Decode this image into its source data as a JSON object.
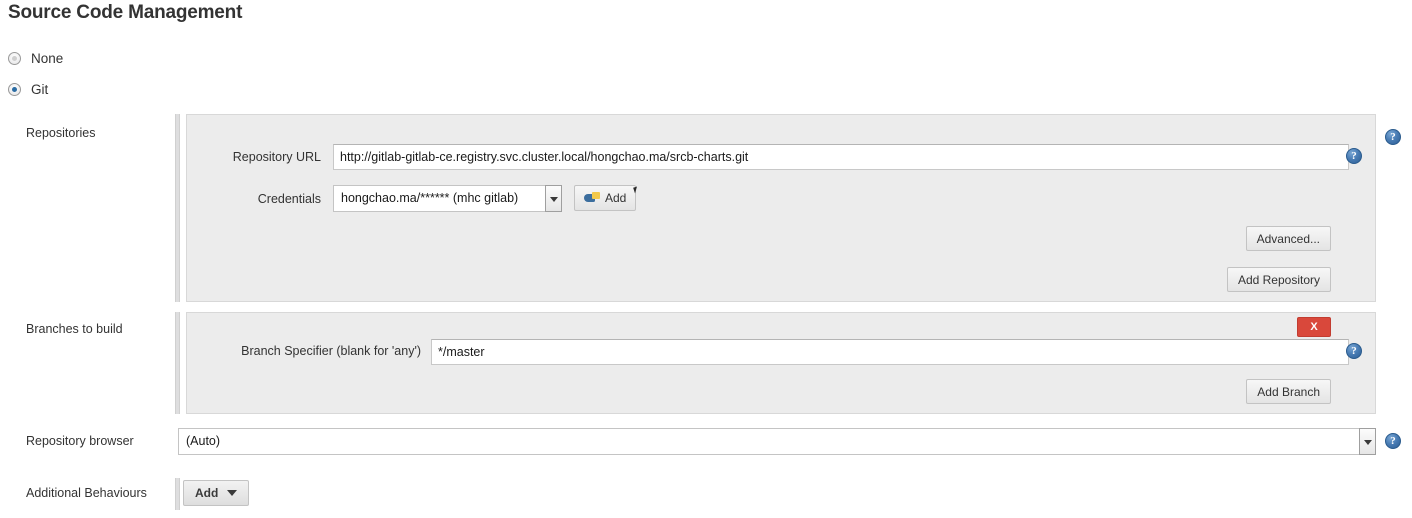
{
  "page": {
    "title": "Source Code Management"
  },
  "scm_type": {
    "options": [
      {
        "label": "None",
        "selected": false
      },
      {
        "label": "Git",
        "selected": true
      }
    ]
  },
  "repositories": {
    "row_label": "Repositories",
    "repository_url": {
      "label": "Repository URL",
      "value": "http://gitlab-gitlab-ce.registry.svc.cluster.local/hongchao.ma/srcb-charts.git"
    },
    "credentials": {
      "label": "Credentials",
      "value": "hongchao.ma/****** (mhc gitlab)",
      "add_button": "Add"
    },
    "advanced_button": "Advanced...",
    "add_repository_button": "Add Repository"
  },
  "branches": {
    "row_label": "Branches to build",
    "branch_specifier": {
      "label": "Branch Specifier (blank for 'any')",
      "value": "*/master"
    },
    "delete_button": "X",
    "add_branch_button": "Add Branch"
  },
  "repository_browser": {
    "row_label": "Repository browser",
    "value": "(Auto)"
  },
  "additional_behaviours": {
    "row_label": "Additional Behaviours",
    "add_button": "Add"
  },
  "help": {
    "glyph": "?"
  },
  "colors": {
    "accent_blue": "#2d5e95",
    "delete_red": "#d9483b",
    "panel_bg": "#ececec"
  }
}
